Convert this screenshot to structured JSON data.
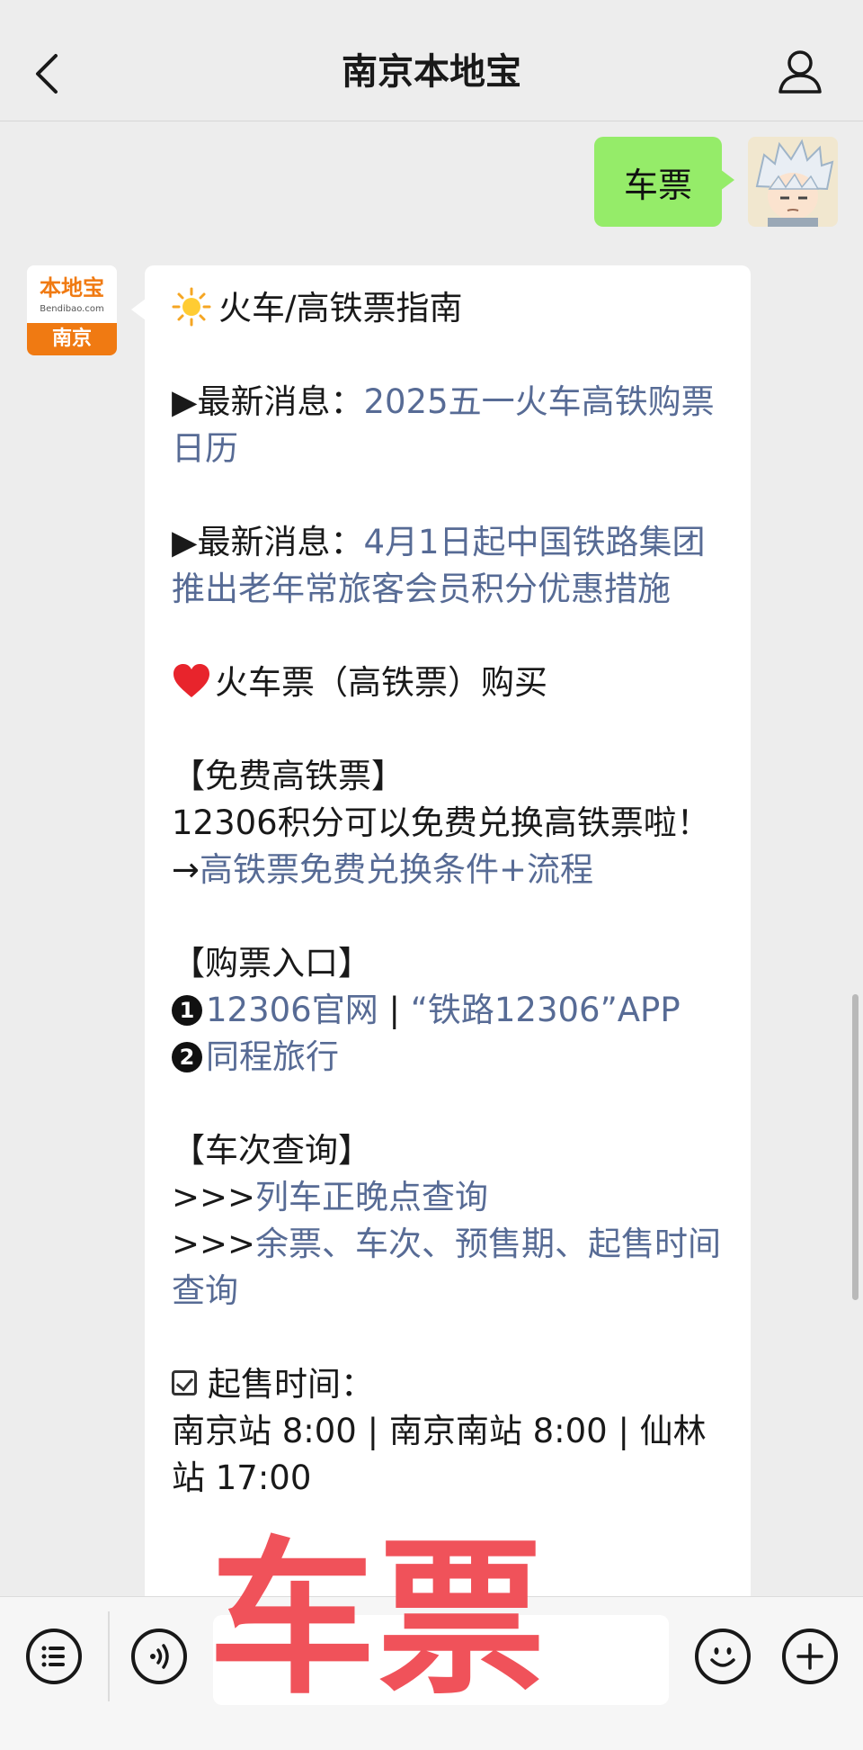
{
  "header": {
    "title": "南京本地宝",
    "back_icon": "chevron-left-icon",
    "profile_icon": "user-icon"
  },
  "outgoing_message": {
    "text": "车票"
  },
  "bot": {
    "logo_text": "本地宝",
    "logo_domain": "Bendibao.com",
    "logo_city": "南京"
  },
  "message": {
    "title": "火车/高铁票指南",
    "news1_prefix": "▶最新消息：",
    "news1_link": "2025五一火车高铁购票日历",
    "news2_prefix": "▶最新消息：",
    "news2_link": "4月1日起中国铁路集团推出老年常旅客会员积分优惠措施",
    "buy_heading": "火车票（高铁票）购买",
    "free_heading": "【免费高铁票】",
    "free_text": "12306积分可以免费兑换高铁票啦！→",
    "free_link": "高铁票免费兑换条件+流程",
    "entry_heading": "【购票入口】",
    "entry1_num": "1",
    "entry1_link_a": "12306官网",
    "entry1_sep": "|",
    "entry1_link_b": "“铁路12306”APP",
    "entry2_num": "2",
    "entry2_link": "同程旅行",
    "query_heading": "【车次查询】",
    "query1_prefix": ">>>",
    "query1_link": "列车正晚点查询",
    "query2_prefix": ">>>",
    "query2_link": "余票、车次、预售期、起售时间查询",
    "sale_heading": "起售时间：",
    "sale_text": "南京站 8:00 | 南京南站 8:00 | 仙林站 17:00"
  },
  "bottom_bar": {
    "menu_icon": "menu-list-icon",
    "voice_icon": "voice-icon",
    "emoji_icon": "emoji-icon",
    "plus_icon": "plus-icon"
  },
  "overlay": {
    "text": "车票"
  },
  "colors": {
    "link": "#576b95",
    "outgoing_bubble": "#95ec69",
    "overlay": "#f0525a",
    "logo_orange": "#f07a12"
  }
}
